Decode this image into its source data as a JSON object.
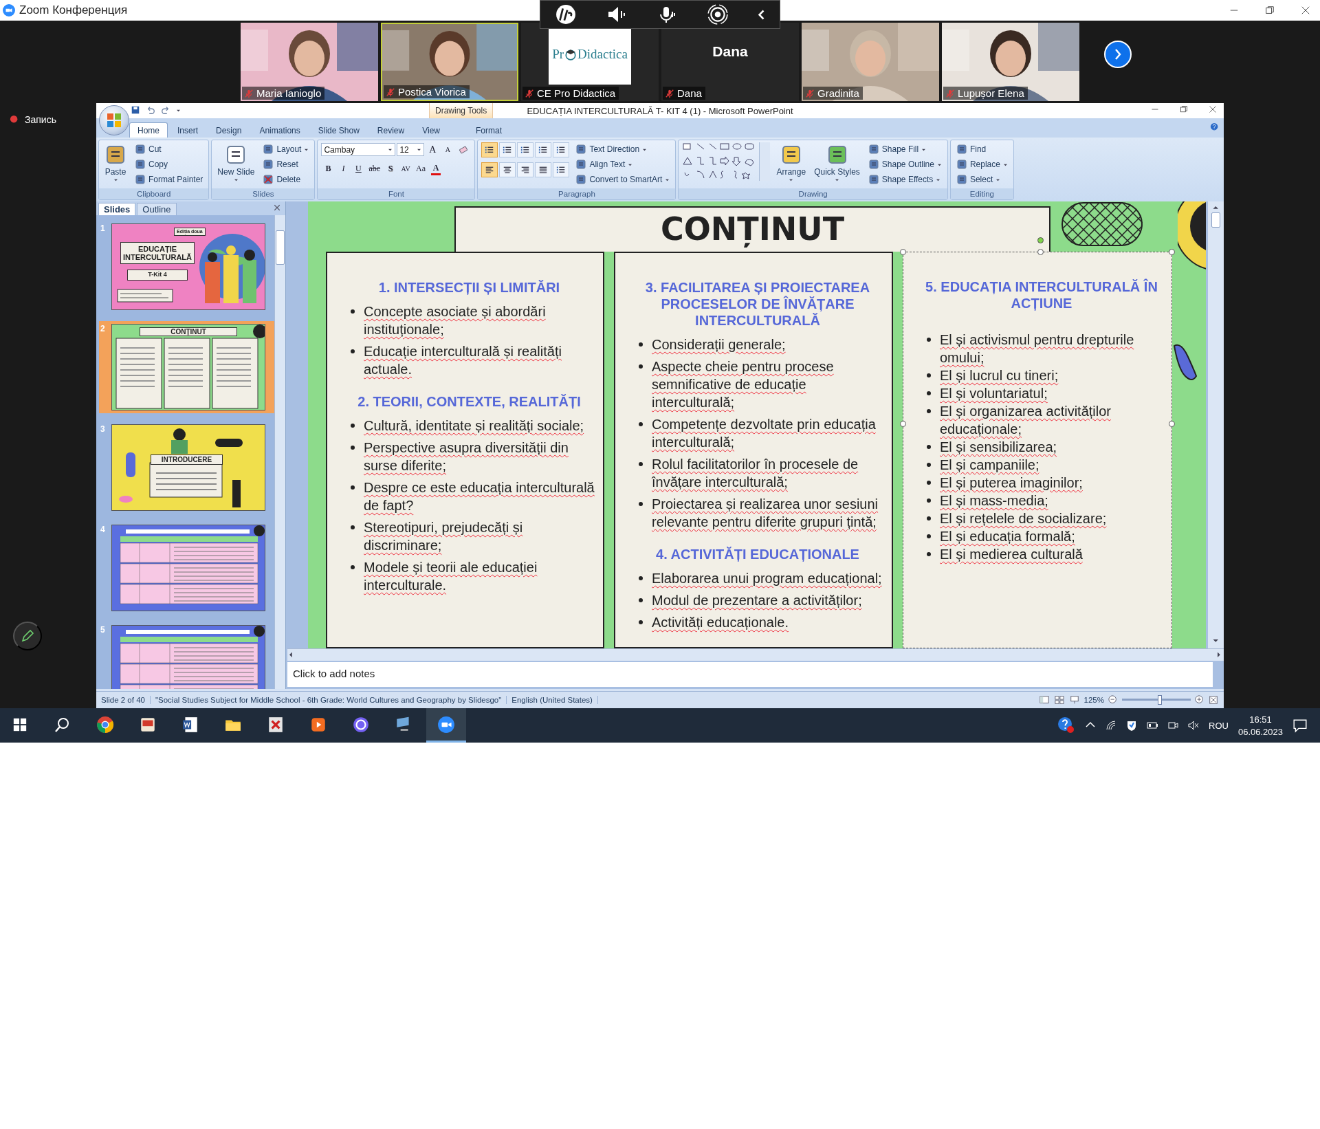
{
  "window": {
    "title": "Zoom Конференция"
  },
  "participants": [
    {
      "name": "Maria Ianioglo",
      "kind": "video",
      "muted": true,
      "speaking": false
    },
    {
      "name": "Postica Viorica",
      "kind": "video",
      "muted": true,
      "speaking": true
    },
    {
      "name": "CE Pro Didactica",
      "kind": "logo",
      "logo_prefix": "Pr",
      "logo_suffix": "Didactica",
      "muted": true,
      "speaking": false
    },
    {
      "name": "Dana",
      "kind": "name",
      "display_name": "Dana",
      "muted": true,
      "speaking": false
    },
    {
      "name": "Gradinita",
      "kind": "video",
      "muted": true,
      "speaking": false
    },
    {
      "name": "Lupușor Elena",
      "kind": "video",
      "muted": true,
      "speaking": false
    }
  ],
  "recording": {
    "label": "Запись"
  },
  "powerpoint": {
    "title": "EDUCAȚIA INTERCULTURALĂ T- KIT 4 (1) - Microsoft PowerPoint",
    "context_tab": "Drawing Tools",
    "tabs": [
      {
        "label": "Home",
        "selected": true
      },
      {
        "label": "Insert",
        "selected": false
      },
      {
        "label": "Design",
        "selected": false
      },
      {
        "label": "Animations",
        "selected": false
      },
      {
        "label": "Slide Show",
        "selected": false
      },
      {
        "label": "Review",
        "selected": false
      },
      {
        "label": "View",
        "selected": false
      },
      {
        "label": "Format",
        "selected": false
      }
    ],
    "groups": [
      {
        "kind": "clipboard",
        "label": "Clipboard",
        "items": [
          {
            "label": "Paste",
            "kind": "large",
            "menu": true
          },
          {
            "label": "Cut",
            "kind": "small",
            "menu": false
          },
          {
            "label": "Copy",
            "kind": "small",
            "menu": false
          },
          {
            "label": "Format Painter",
            "kind": "small",
            "menu": false
          }
        ]
      },
      {
        "kind": "slides",
        "label": "Slides",
        "items": [
          {
            "label": "New Slide",
            "kind": "large",
            "menu": true
          },
          {
            "label": "Layout",
            "kind": "small",
            "menu": true
          },
          {
            "label": "Reset",
            "kind": "small",
            "menu": false
          },
          {
            "label": "Delete",
            "kind": "small",
            "menu": false
          }
        ]
      },
      {
        "kind": "font",
        "label": "Font",
        "font": "Cambay",
        "size": "12",
        "buttons": [
          {
            "label": "B",
            "kind": "bold"
          },
          {
            "label": "I",
            "kind": "italic"
          },
          {
            "label": "U",
            "kind": "underline"
          },
          {
            "label": "abc",
            "kind": "strike"
          },
          {
            "label": "S",
            "kind": "shadow"
          },
          {
            "label": "AV",
            "kind": "spacing"
          },
          {
            "label": "Aa",
            "kind": "case"
          },
          {
            "label": "A",
            "kind": "color"
          }
        ],
        "size_buttons": [
          {
            "label": "A",
            "kind": "grow"
          },
          {
            "label": "A",
            "kind": "shrink"
          }
        ]
      },
      {
        "kind": "paragraph",
        "label": "Paragraph",
        "tools": [
          {
            "kind": "bullets",
            "selected": true
          },
          {
            "kind": "numbering",
            "selected": false
          },
          {
            "kind": "outdent",
            "selected": false
          },
          {
            "kind": "indent",
            "selected": false
          },
          {
            "kind": "spacing",
            "selected": false
          },
          {
            "kind": "left",
            "selected": true
          },
          {
            "kind": "center",
            "selected": false
          },
          {
            "kind": "right",
            "selected": false
          },
          {
            "kind": "justify",
            "selected": false
          },
          {
            "kind": "columns",
            "selected": false
          }
        ],
        "items": [
          {
            "label": "Text Direction",
            "kind": "small",
            "menu": true
          },
          {
            "label": "Align Text",
            "kind": "small",
            "menu": true
          },
          {
            "label": "Convert to SmartArt",
            "kind": "small",
            "menu": true
          }
        ]
      },
      {
        "kind": "drawing",
        "label": "Drawing",
        "items": [
          {
            "label": "Arrange",
            "kind": "large",
            "menu": true
          },
          {
            "label": "Quick Styles",
            "kind": "large",
            "menu": true
          },
          {
            "label": "Shape Fill",
            "kind": "small",
            "menu": true
          },
          {
            "label": "Shape Outline",
            "kind": "small",
            "menu": true
          },
          {
            "label": "Shape Effects",
            "kind": "small",
            "menu": true
          }
        ]
      },
      {
        "kind": "editing",
        "label": "Editing",
        "items": [
          {
            "label": "Find",
            "kind": "small",
            "menu": false
          },
          {
            "label": "Replace",
            "kind": "small",
            "menu": true
          },
          {
            "label": "Select",
            "kind": "small",
            "menu": true
          }
        ]
      }
    ],
    "panel_tabs": [
      {
        "label": "Slides",
        "selected": true
      },
      {
        "label": "Outline",
        "selected": false
      }
    ],
    "thumbnails": [
      {
        "number": "1",
        "kind": "cover",
        "selected": false,
        "badge": "Ediția doua",
        "title": "EDUCAȚIE INTERCULTURALĂ",
        "subtitle": "T-Kit 4"
      },
      {
        "number": "2",
        "kind": "contents",
        "selected": true,
        "title": "CONȚINUT"
      },
      {
        "number": "3",
        "kind": "intro",
        "selected": false,
        "title": "INTRODUCERE"
      },
      {
        "number": "4",
        "kind": "table",
        "selected": false
      },
      {
        "number": "5",
        "kind": "table",
        "selected": false
      }
    ],
    "slide": {
      "title": "CONȚINUT",
      "columns": [
        {
          "selected": false,
          "sections": [
            {
              "heading": "1. INTERSECȚII ȘI LIMITĂRI",
              "bullets": [
                "Concepte asociate și abordări instituționale;",
                "Educație interculturală și realități actuale."
              ]
            },
            {
              "heading": "2. TEORII, CONTEXTE, REALITĂȚI",
              "bullets": [
                "Cultură, identitate și realități sociale;",
                "Perspective asupra diversității din surse diferite;",
                "Despre ce este educația interculturală de fapt?",
                "Stereotipuri, prejudecăți și discriminare;",
                "Modele și teorii ale educației interculturale."
              ]
            }
          ]
        },
        {
          "selected": false,
          "sections": [
            {
              "heading": "3. FACILITAREA ȘI PROIECTAREA PROCESELOR DE ÎNVĂȚARE INTERCULTURALĂ",
              "bullets": [
                "Considerații generale;",
                "Aspecte cheie pentru procese semnificative de educație interculturală;",
                "Competențe dezvoltate prin educația interculturală;",
                "Rolul facilitatorilor în procesele de învățare interculturală;",
                "Proiectarea și realizarea unor sesiuni relevante pentru diferite grupuri țintă;"
              ]
            },
            {
              "heading": "4. ACTIVITĂȚI EDUCAȚIONALE",
              "bullets": [
                "Elaborarea unui program educațional;",
                "Modul de prezentare a activităților;",
                "Activități educaționale."
              ]
            }
          ]
        },
        {
          "selected": true,
          "sections": [
            {
              "heading": "5. EDUCAȚIA INTERCULTURALĂ ÎN ACȚIUNE",
              "bullets": [
                "El și activismul pentru drepturile omului;",
                "El și lucrul cu tineri;",
                "El și voluntariatul;",
                "El și organizarea activităților educaționale;",
                "El și sensibilizarea;",
                "El și campaniile;",
                "El și puterea imaginilor;",
                "El și mass-media;",
                "El și rețelele de socializare;",
                "El și educația formală;",
                "El și medierea culturală"
              ]
            }
          ]
        }
      ]
    },
    "notes": {
      "placeholder": "Click to add notes"
    },
    "status_bar": {
      "items": [
        "Slide 2 of 40",
        "\"Social Studies Subject for Middle School - 6th Grade: World Cultures and Geography by Slidesgo\"",
        "English (United States)"
      ],
      "zoom": "125%",
      "zoom_slider": {
        "level": 0.55
      }
    }
  },
  "taskbar": {
    "apps": [
      {
        "kind": "chrome",
        "selected": false
      },
      {
        "kind": "reader",
        "selected": false
      },
      {
        "kind": "word",
        "selected": false
      },
      {
        "kind": "folder",
        "selected": false
      },
      {
        "kind": "pdf",
        "selected": false
      },
      {
        "kind": "player",
        "selected": false
      },
      {
        "kind": "viber",
        "selected": false
      },
      {
        "kind": "monitor",
        "selected": false
      },
      {
        "kind": "zoom",
        "selected": true
      }
    ],
    "language": "ROU",
    "time": "16:51",
    "date": "06.06.2023"
  }
}
